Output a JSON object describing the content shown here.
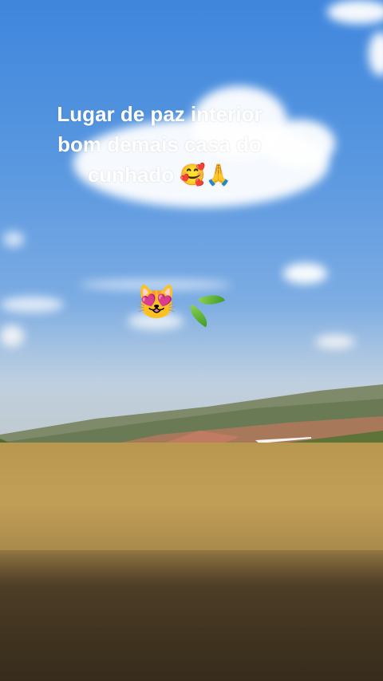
{
  "caption": {
    "line1": "Lugar de paz interior",
    "line2": "bom demais casa do",
    "line3": "cunhado 🥰🙏"
  },
  "stickers": {
    "cat_face": "😻"
  },
  "colors": {
    "sky_top": "#3f86dc",
    "grass": "#c29f56",
    "caption_text": "#ffffff"
  }
}
